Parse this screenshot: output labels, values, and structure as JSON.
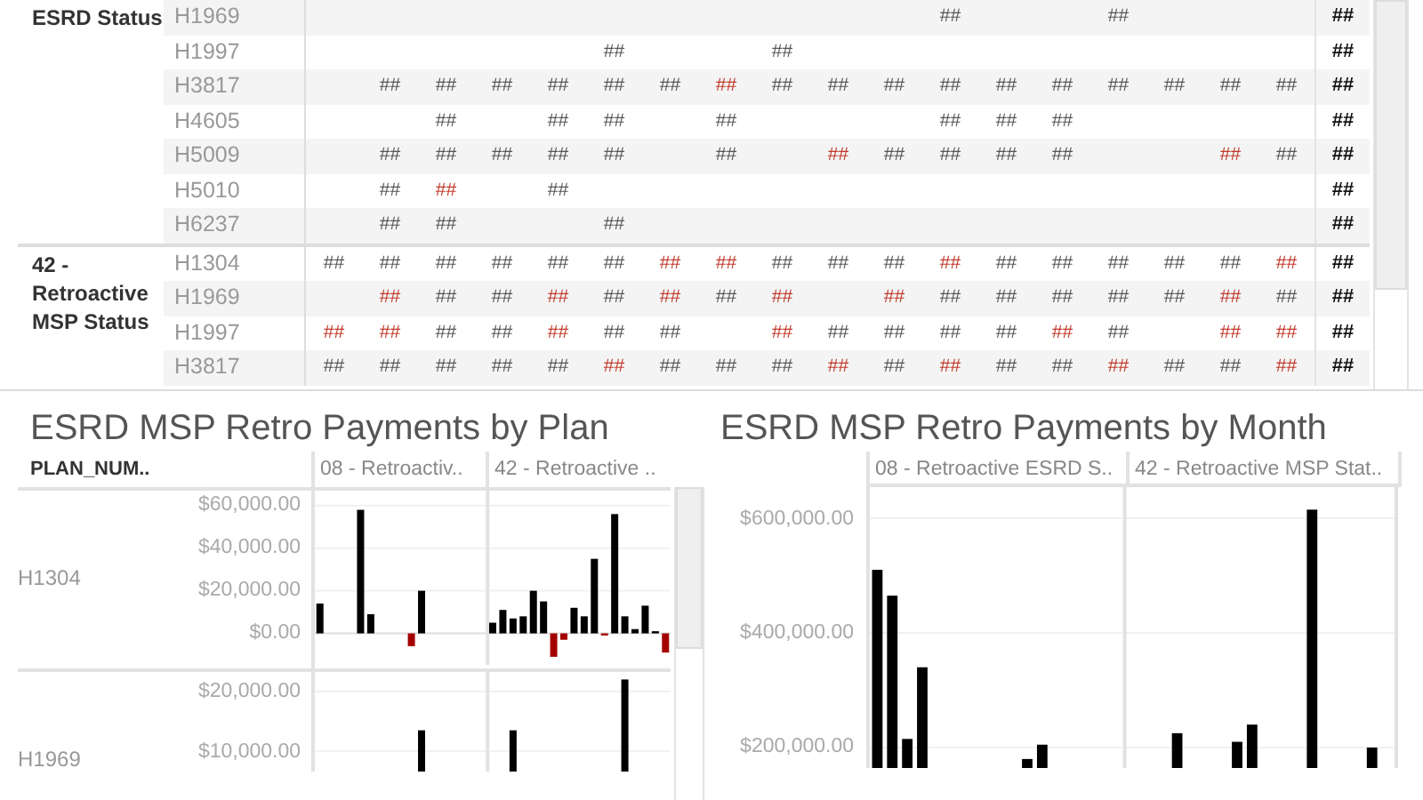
{
  "table": {
    "groups": [
      {
        "label": "ESRD Status",
        "rows": [
          {
            "plan": "H1969",
            "cells": [
              null,
              null,
              null,
              null,
              null,
              null,
              null,
              null,
              null,
              null,
              null,
              {
                "text": "##",
                "negative": false
              },
              null,
              null,
              {
                "text": "##",
                "negative": false
              },
              null,
              null,
              null
            ],
            "total": "##"
          },
          {
            "plan": "H1997",
            "cells": [
              null,
              null,
              null,
              null,
              null,
              {
                "text": "##",
                "negative": false
              },
              null,
              null,
              {
                "text": "##",
                "negative": false
              },
              null,
              null,
              null,
              null,
              null,
              null,
              null,
              null,
              null
            ],
            "total": "##"
          },
          {
            "plan": "H3817",
            "cells": [
              null,
              {
                "text": "##",
                "negative": false
              },
              {
                "text": "##",
                "negative": false
              },
              {
                "text": "##",
                "negative": false
              },
              {
                "text": "##",
                "negative": false
              },
              {
                "text": "##",
                "negative": false
              },
              {
                "text": "##",
                "negative": false
              },
              {
                "text": "##",
                "negative": true
              },
              {
                "text": "##",
                "negative": false
              },
              {
                "text": "##",
                "negative": false
              },
              {
                "text": "##",
                "negative": false
              },
              {
                "text": "##",
                "negative": false
              },
              {
                "text": "##",
                "negative": false
              },
              {
                "text": "##",
                "negative": false
              },
              {
                "text": "##",
                "negative": false
              },
              {
                "text": "##",
                "negative": false
              },
              {
                "text": "##",
                "negative": false
              },
              {
                "text": "##",
                "negative": false
              }
            ],
            "total": "##"
          },
          {
            "plan": "H4605",
            "cells": [
              null,
              null,
              {
                "text": "##",
                "negative": false
              },
              null,
              {
                "text": "##",
                "negative": false
              },
              {
                "text": "##",
                "negative": false
              },
              null,
              {
                "text": "##",
                "negative": false
              },
              null,
              null,
              null,
              {
                "text": "##",
                "negative": false
              },
              {
                "text": "##",
                "negative": false
              },
              {
                "text": "##",
                "negative": false
              },
              null,
              null,
              null,
              null
            ],
            "total": "##"
          },
          {
            "plan": "H5009",
            "cells": [
              null,
              {
                "text": "##",
                "negative": false
              },
              {
                "text": "##",
                "negative": false
              },
              {
                "text": "##",
                "negative": false
              },
              {
                "text": "##",
                "negative": false
              },
              {
                "text": "##",
                "negative": false
              },
              null,
              {
                "text": "##",
                "negative": false
              },
              null,
              {
                "text": "##",
                "negative": true
              },
              {
                "text": "##",
                "negative": false
              },
              {
                "text": "##",
                "negative": false
              },
              {
                "text": "##",
                "negative": false
              },
              {
                "text": "##",
                "negative": false
              },
              null,
              null,
              {
                "text": "##",
                "negative": true
              },
              {
                "text": "##",
                "negative": false
              }
            ],
            "total": "##"
          },
          {
            "plan": "H5010",
            "cells": [
              null,
              {
                "text": "##",
                "negative": false
              },
              {
                "text": "##",
                "negative": true
              },
              null,
              {
                "text": "##",
                "negative": false
              },
              null,
              null,
              null,
              null,
              null,
              null,
              null,
              null,
              null,
              null,
              null,
              null,
              null
            ],
            "total": "##"
          },
          {
            "plan": "H6237",
            "cells": [
              null,
              {
                "text": "##",
                "negative": false
              },
              {
                "text": "##",
                "negative": false
              },
              null,
              null,
              {
                "text": "##",
                "negative": false
              },
              null,
              null,
              null,
              null,
              null,
              null,
              null,
              null,
              null,
              null,
              null,
              null
            ],
            "total": "##"
          }
        ]
      },
      {
        "label": "42 - Retroactive MSP Status",
        "rows": [
          {
            "plan": "H1304",
            "cells": [
              {
                "text": "##",
                "negative": false
              },
              {
                "text": "##",
                "negative": false
              },
              {
                "text": "##",
                "negative": false
              },
              {
                "text": "##",
                "negative": false
              },
              {
                "text": "##",
                "negative": false
              },
              {
                "text": "##",
                "negative": false
              },
              {
                "text": "##",
                "negative": true
              },
              {
                "text": "##",
                "negative": true
              },
              {
                "text": "##",
                "negative": false
              },
              {
                "text": "##",
                "negative": false
              },
              {
                "text": "##",
                "negative": false
              },
              {
                "text": "##",
                "negative": true
              },
              {
                "text": "##",
                "negative": false
              },
              {
                "text": "##",
                "negative": false
              },
              {
                "text": "##",
                "negative": false
              },
              {
                "text": "##",
                "negative": false
              },
              {
                "text": "##",
                "negative": false
              },
              {
                "text": "##",
                "negative": true
              }
            ],
            "total": "##"
          },
          {
            "plan": "H1969",
            "cells": [
              null,
              {
                "text": "##",
                "negative": true
              },
              {
                "text": "##",
                "negative": false
              },
              {
                "text": "##",
                "negative": false
              },
              {
                "text": "##",
                "negative": true
              },
              {
                "text": "##",
                "negative": false
              },
              {
                "text": "##",
                "negative": true
              },
              {
                "text": "##",
                "negative": false
              },
              {
                "text": "##",
                "negative": true
              },
              null,
              {
                "text": "##",
                "negative": true
              },
              {
                "text": "##",
                "negative": false
              },
              {
                "text": "##",
                "negative": false
              },
              {
                "text": "##",
                "negative": false
              },
              {
                "text": "##",
                "negative": false
              },
              {
                "text": "##",
                "negative": false
              },
              {
                "text": "##",
                "negative": true
              },
              {
                "text": "##",
                "negative": false
              }
            ],
            "total": "##"
          },
          {
            "plan": "H1997",
            "cells": [
              {
                "text": "##",
                "negative": true
              },
              {
                "text": "##",
                "negative": true
              },
              {
                "text": "##",
                "negative": false
              },
              {
                "text": "##",
                "negative": false
              },
              {
                "text": "##",
                "negative": true
              },
              {
                "text": "##",
                "negative": false
              },
              {
                "text": "##",
                "negative": false
              },
              null,
              {
                "text": "##",
                "negative": true
              },
              {
                "text": "##",
                "negative": false
              },
              {
                "text": "##",
                "negative": false
              },
              {
                "text": "##",
                "negative": false
              },
              {
                "text": "##",
                "negative": false
              },
              {
                "text": "##",
                "negative": true
              },
              {
                "text": "##",
                "negative": false
              },
              null,
              {
                "text": "##",
                "negative": true
              },
              {
                "text": "##",
                "negative": true
              }
            ],
            "total": "##"
          },
          {
            "plan": "H3817",
            "cells": [
              {
                "text": "##",
                "negative": false
              },
              {
                "text": "##",
                "negative": false
              },
              {
                "text": "##",
                "negative": false
              },
              {
                "text": "##",
                "negative": false
              },
              {
                "text": "##",
                "negative": false
              },
              {
                "text": "##",
                "negative": true
              },
              {
                "text": "##",
                "negative": false
              },
              {
                "text": "##",
                "negative": false
              },
              {
                "text": "##",
                "negative": false
              },
              {
                "text": "##",
                "negative": true
              },
              {
                "text": "##",
                "negative": false
              },
              {
                "text": "##",
                "negative": true
              },
              {
                "text": "##",
                "negative": false
              },
              {
                "text": "##",
                "negative": false
              },
              {
                "text": "##",
                "negative": true
              },
              {
                "text": "##",
                "negative": false
              },
              {
                "text": "##",
                "negative": false
              },
              {
                "text": "##",
                "negative": true
              }
            ],
            "total": "##"
          }
        ]
      }
    ]
  },
  "plan_chart": {
    "title": "ESRD MSP Retro Payments by Plan",
    "row_header": "PLAN_NUM..",
    "columns": [
      "08 - Retroactiv..",
      "42 - Retroactive .."
    ],
    "rows": [
      {
        "plan": "H1304",
        "chart_data": {
          "type": "bar",
          "grid": true,
          "ylim": [
            -14800,
            67000
          ],
          "yticks": [
            {
              "value": 0,
              "label": "$0.00"
            },
            {
              "value": 20000,
              "label": "$20,000.00"
            },
            {
              "value": 40000,
              "label": "$40,000.00"
            },
            {
              "value": 60000,
              "label": "$60,000.00"
            }
          ],
          "series": [
            {
              "color": "#000000",
              "values": [
                14000,
                null,
                null,
                null,
                58000,
                9000,
                null,
                null,
                null,
                null,
                20000,
                null,
                null,
                null,
                null,
                null,
                null,
                5000,
                11000,
                7000,
                8000,
                20000,
                15000,
                null,
                null,
                12000,
                8000,
                35000,
                null,
                56000,
                8000,
                2000,
                13000,
                1000,
                null
              ]
            },
            {
              "color": "#a50000",
              "values": [
                null,
                null,
                null,
                null,
                null,
                null,
                null,
                null,
                null,
                -6000,
                null,
                null,
                null,
                null,
                null,
                null,
                null,
                null,
                null,
                null,
                null,
                null,
                null,
                -11000,
                -3000,
                null,
                null,
                null,
                -1000,
                null,
                null,
                null,
                null,
                null,
                -9000
              ]
            }
          ]
        }
      },
      {
        "plan": "H1969",
        "chart_data": {
          "type": "bar",
          "grid": true,
          "ylim": [
            6600,
            23250
          ],
          "yticks": [
            {
              "value": 10000,
              "label": "$10,000.00"
            },
            {
              "value": 20000,
              "label": "$20,000.00"
            }
          ],
          "series": [
            {
              "color": "#000000",
              "values": [
                null,
                null,
                null,
                null,
                null,
                null,
                null,
                null,
                null,
                null,
                13500,
                null,
                null,
                null,
                null,
                null,
                null,
                null,
                null,
                13500,
                null,
                null,
                null,
                null,
                null,
                null,
                null,
                null,
                null,
                null,
                22000,
                null,
                null,
                null,
                null
              ]
            }
          ]
        }
      }
    ]
  },
  "month_chart": {
    "title": "ESRD MSP Retro Payments by Month",
    "columns": [
      "08 - Retroactive ESRD S..",
      "42 - Retroactive MSP Stat.."
    ],
    "chart_data": {
      "type": "bar",
      "grid": true,
      "ylim": [
        164300,
        654300
      ],
      "yticks": [
        {
          "value": 200000,
          "label": "$200,000.00"
        },
        {
          "value": 400000,
          "label": "$400,000.00"
        },
        {
          "value": 600000,
          "label": "$600,000.00"
        }
      ],
      "series": [
        {
          "color": "#000000",
          "values": [
            510000,
            465000,
            215000,
            340000,
            null,
            null,
            null,
            null,
            null,
            null,
            180000,
            205000,
            null,
            null,
            null,
            null,
            null,
            null,
            null,
            null,
            225000,
            null,
            null,
            null,
            210000,
            240000,
            null,
            null,
            null,
            615000,
            null,
            null,
            null,
            200000,
            null
          ]
        }
      ]
    }
  }
}
